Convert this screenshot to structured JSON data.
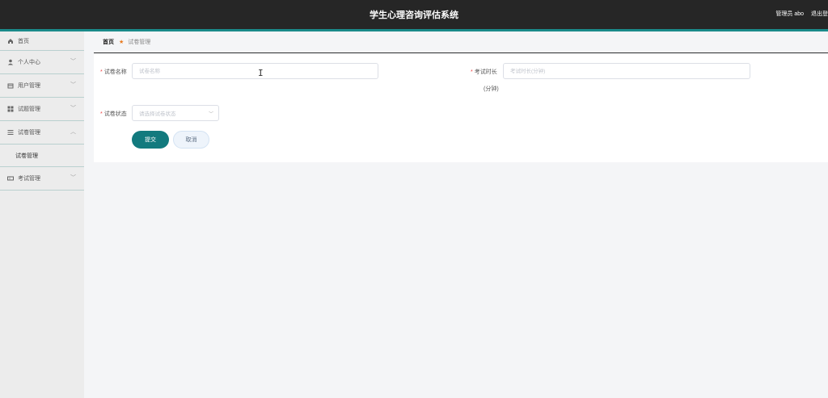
{
  "header": {
    "title": "学生心理咨询评估系统",
    "user_label": "管理员 abo",
    "logout_label": "退出登"
  },
  "sidebar": {
    "items": [
      {
        "label": "首页",
        "icon": "home-icon"
      },
      {
        "label": "个人中心",
        "icon": "user-icon"
      },
      {
        "label": "用户管理",
        "icon": "building-icon"
      },
      {
        "label": "试题管理",
        "icon": "grid-icon"
      },
      {
        "label": "试卷管理",
        "icon": "list-icon",
        "expanded": true,
        "children": [
          "试卷管理"
        ]
      },
      {
        "label": "考试管理",
        "icon": "ticket-icon"
      }
    ]
  },
  "breadcrumb": {
    "home": "首页",
    "current": "试卷管理"
  },
  "form": {
    "name_label": "试卷名称",
    "name_placeholder": "试卷名称",
    "duration_label": "考试时长",
    "duration_unit": "(分钟)",
    "duration_placeholder": "考试时长(分钟)",
    "status_label": "试卷状态",
    "status_placeholder": "请选择试卷状态",
    "submit_label": "提交",
    "cancel_label": "取消"
  },
  "colors": {
    "topbar": "#262626",
    "accent": "#1a8a8a",
    "submit": "#127a7e",
    "required": "#e44444"
  }
}
